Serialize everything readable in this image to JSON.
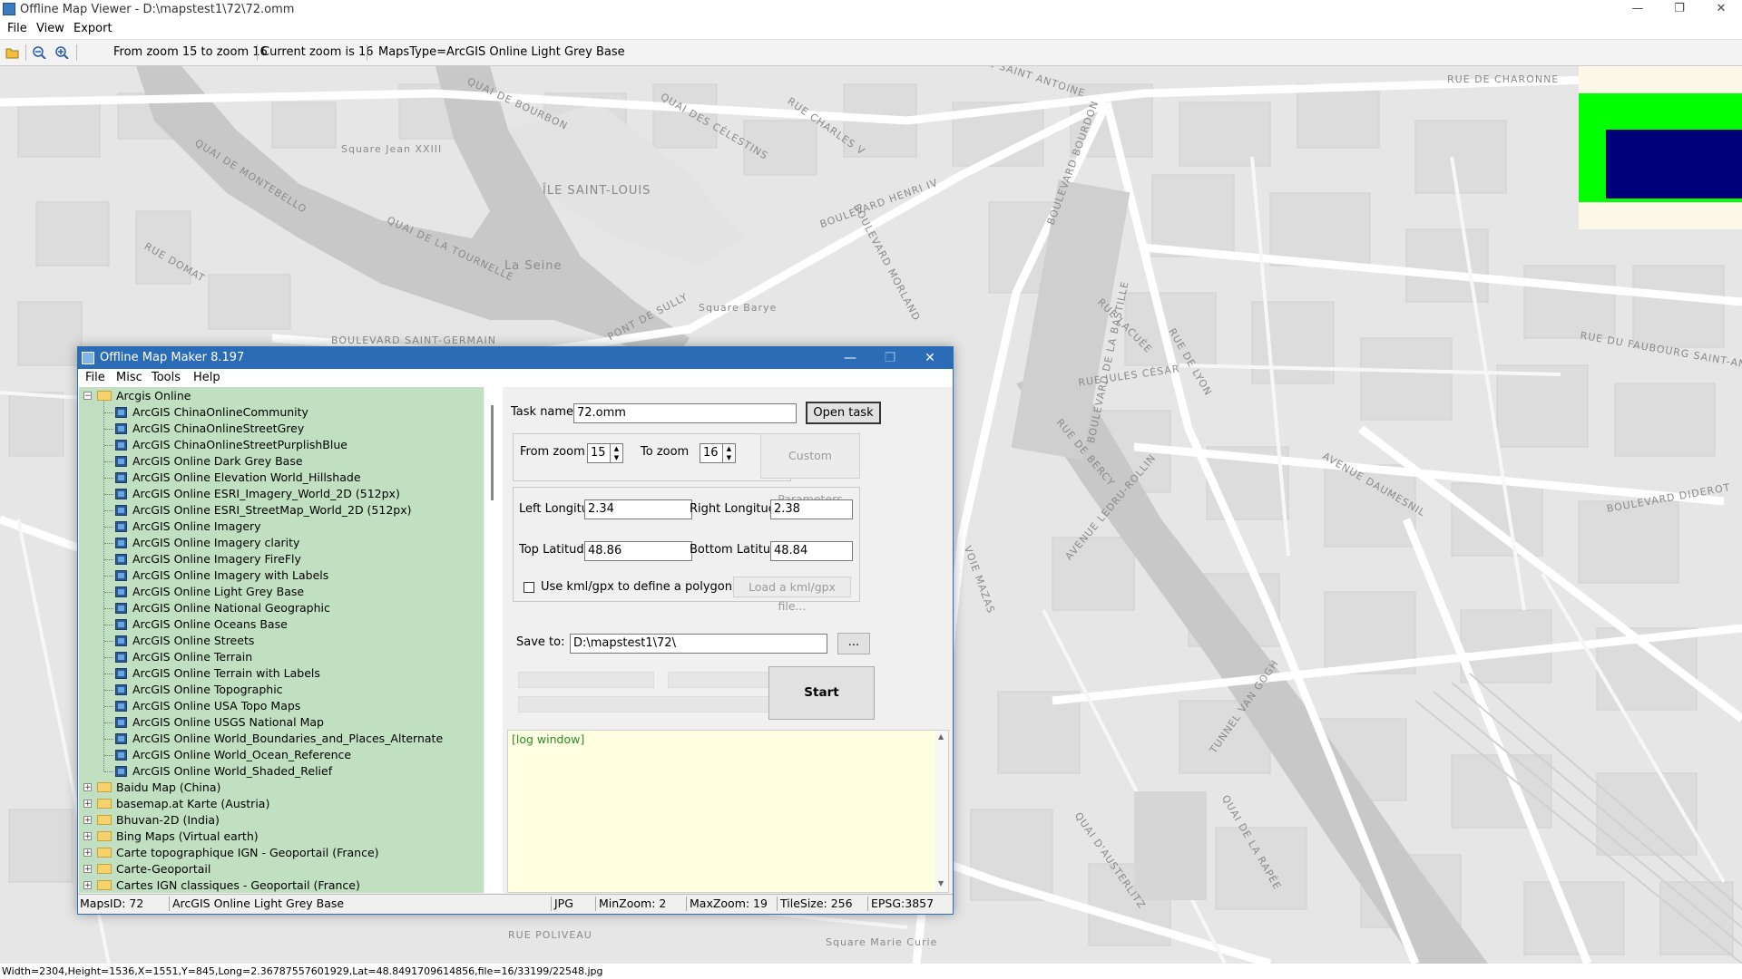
{
  "window": {
    "title": "Offline Map Viewer - D:\\mapstest1\\72\\72.omm",
    "minimize_glyph": "—",
    "maximize_glyph": "❐",
    "close_glyph": "✕"
  },
  "menubar": {
    "items": [
      "File",
      "View",
      "Export"
    ]
  },
  "toolbar": {
    "icons": [
      "folder-open-icon",
      "zoom-out-icon",
      "zoom-in-icon"
    ],
    "zoom_range": "From zoom 15 to zoom 16",
    "current_zoom": "Current zoom is 16",
    "maps_type": "MapsType=ArcGIS Online Light Grey Base"
  },
  "map": {
    "labels": [
      "RUE SAINT ANTOINE",
      "RUE DE CHARONNE",
      "QUAI DE BOURBON",
      "QUAI DES CÉLESTINS",
      "Square Jean XXIII",
      "ÎLE SAINT-LOUIS",
      "QUAI DE MONTEBELLO",
      "BOULEVARD HENRI IV",
      "La Seine",
      "QUAI DE LA TOURNELLE",
      "BOULEVARD SAINT-GERMAIN",
      "PONT DE SULLY",
      "Square Barye",
      "BOULEVARD MORLAND",
      "BOULEVARD BOURDON",
      "BOULEVARD DE LA BASTILLE",
      "RUE JULES CÉSAR",
      "AVENUE DAUMESNIL",
      "AVENUE LEDRU-ROLLIN",
      "BOULEVARD DIDEROT",
      "VOIE MAZAS",
      "RUE DE BERCY",
      "QUAI D'AUSTERLITZ",
      "TUNNEL VAN GOGH",
      "QUAI DE LA RAPÉE",
      "RUE DU FAUBOURG SAINT-ANTOINE",
      "RUE POLIVEAU",
      "Square Marie Curie",
      "RUE CHARLES V",
      "RUE DOMAT",
      "RUE LACUÉE",
      "RUE DE LYON"
    ],
    "overview_colors": {
      "background": "#fdf7e8",
      "extent": "#00ff00",
      "view": "#00007a"
    }
  },
  "statusline": "Width=2304,Height=1536,X=1551,Y=845,Long=2.36787557601929,Lat=48.8491709614856,file=16/33199/22548.jpg",
  "dialog": {
    "title": "Offline Map Maker 8.197",
    "menu": [
      "File",
      "Misc",
      "Tools",
      "Help"
    ],
    "tree": {
      "root": "Arcgis Online",
      "children": [
        "ArcGIS ChinaOnlineCommunity",
        "ArcGIS ChinaOnlineStreetGrey",
        "ArcGIS ChinaOnlineStreetPurplishBlue",
        "ArcGIS Online Dark Grey Base",
        "ArcGIS Online Elevation World_Hillshade",
        "ArcGIS Online ESRI_Imagery_World_2D (512px)",
        "ArcGIS Online ESRI_StreetMap_World_2D (512px)",
        "ArcGIS Online Imagery",
        "ArcGIS Online Imagery clarity",
        "ArcGIS Online Imagery FireFly",
        "ArcGIS Online Imagery with Labels",
        "ArcGIS Online Light Grey Base",
        "ArcGIS Online National Geographic",
        "ArcGIS Online Oceans Base",
        "ArcGIS Online Streets",
        "ArcGIS Online Terrain",
        "ArcGIS Online Terrain with Labels",
        "ArcGIS Online Topographic",
        "ArcGIS Online USA Topo Maps",
        "ArcGIS Online USGS National Map",
        "ArcGIS Online World_Boundaries_and_Places_Alternate",
        "ArcGIS Online World_Ocean_Reference",
        "ArcGIS Online World_Shaded_Relief"
      ],
      "folders": [
        "Baidu Map (China)",
        "basemap.at Karte (Austria)",
        "Bhuvan-2D (India)",
        "Bing Maps (Virtual earth)",
        "Carte topographique IGN - Geoportail (France)",
        "Carte-Geoportail",
        "Cartes IGN classiques - Geoportail (France)"
      ]
    },
    "form": {
      "task_name_label": "Task name",
      "task_name_value": "72.omm",
      "open_task_label": "Open task ...",
      "from_zoom_label": "From zoom",
      "from_zoom_value": "15",
      "to_zoom_label": "To zoom",
      "to_zoom_value": "16",
      "custom_params_label": "Custom Parameters",
      "left_lon_label": "Left Longitude",
      "left_lon_value": "2.34",
      "right_lon_label": "Right Longitude",
      "right_lon_value": "2.38",
      "top_lat_label": "Top Latitude",
      "top_lat_value": "48.86",
      "bottom_lat_label": "Bottom Latitude",
      "bottom_lat_value": "48.84",
      "use_kml_label": "Use kml/gpx to define a polygon area",
      "load_kml_label": "Load a kml/gpx file...",
      "save_to_label": "Save to:",
      "save_to_value": "D:\\mapstest1\\72\\",
      "browse_label": "...",
      "start_label": "Start"
    },
    "log": "[log window]",
    "status": {
      "maps_id": "MapsID: 72",
      "maps_name": "ArcGIS Online Light Grey Base",
      "format": "JPG",
      "min_zoom": "MinZoom: 2",
      "max_zoom": "MaxZoom: 19",
      "tile_size": "TileSize: 256",
      "epsg": "EPSG:3857"
    }
  }
}
